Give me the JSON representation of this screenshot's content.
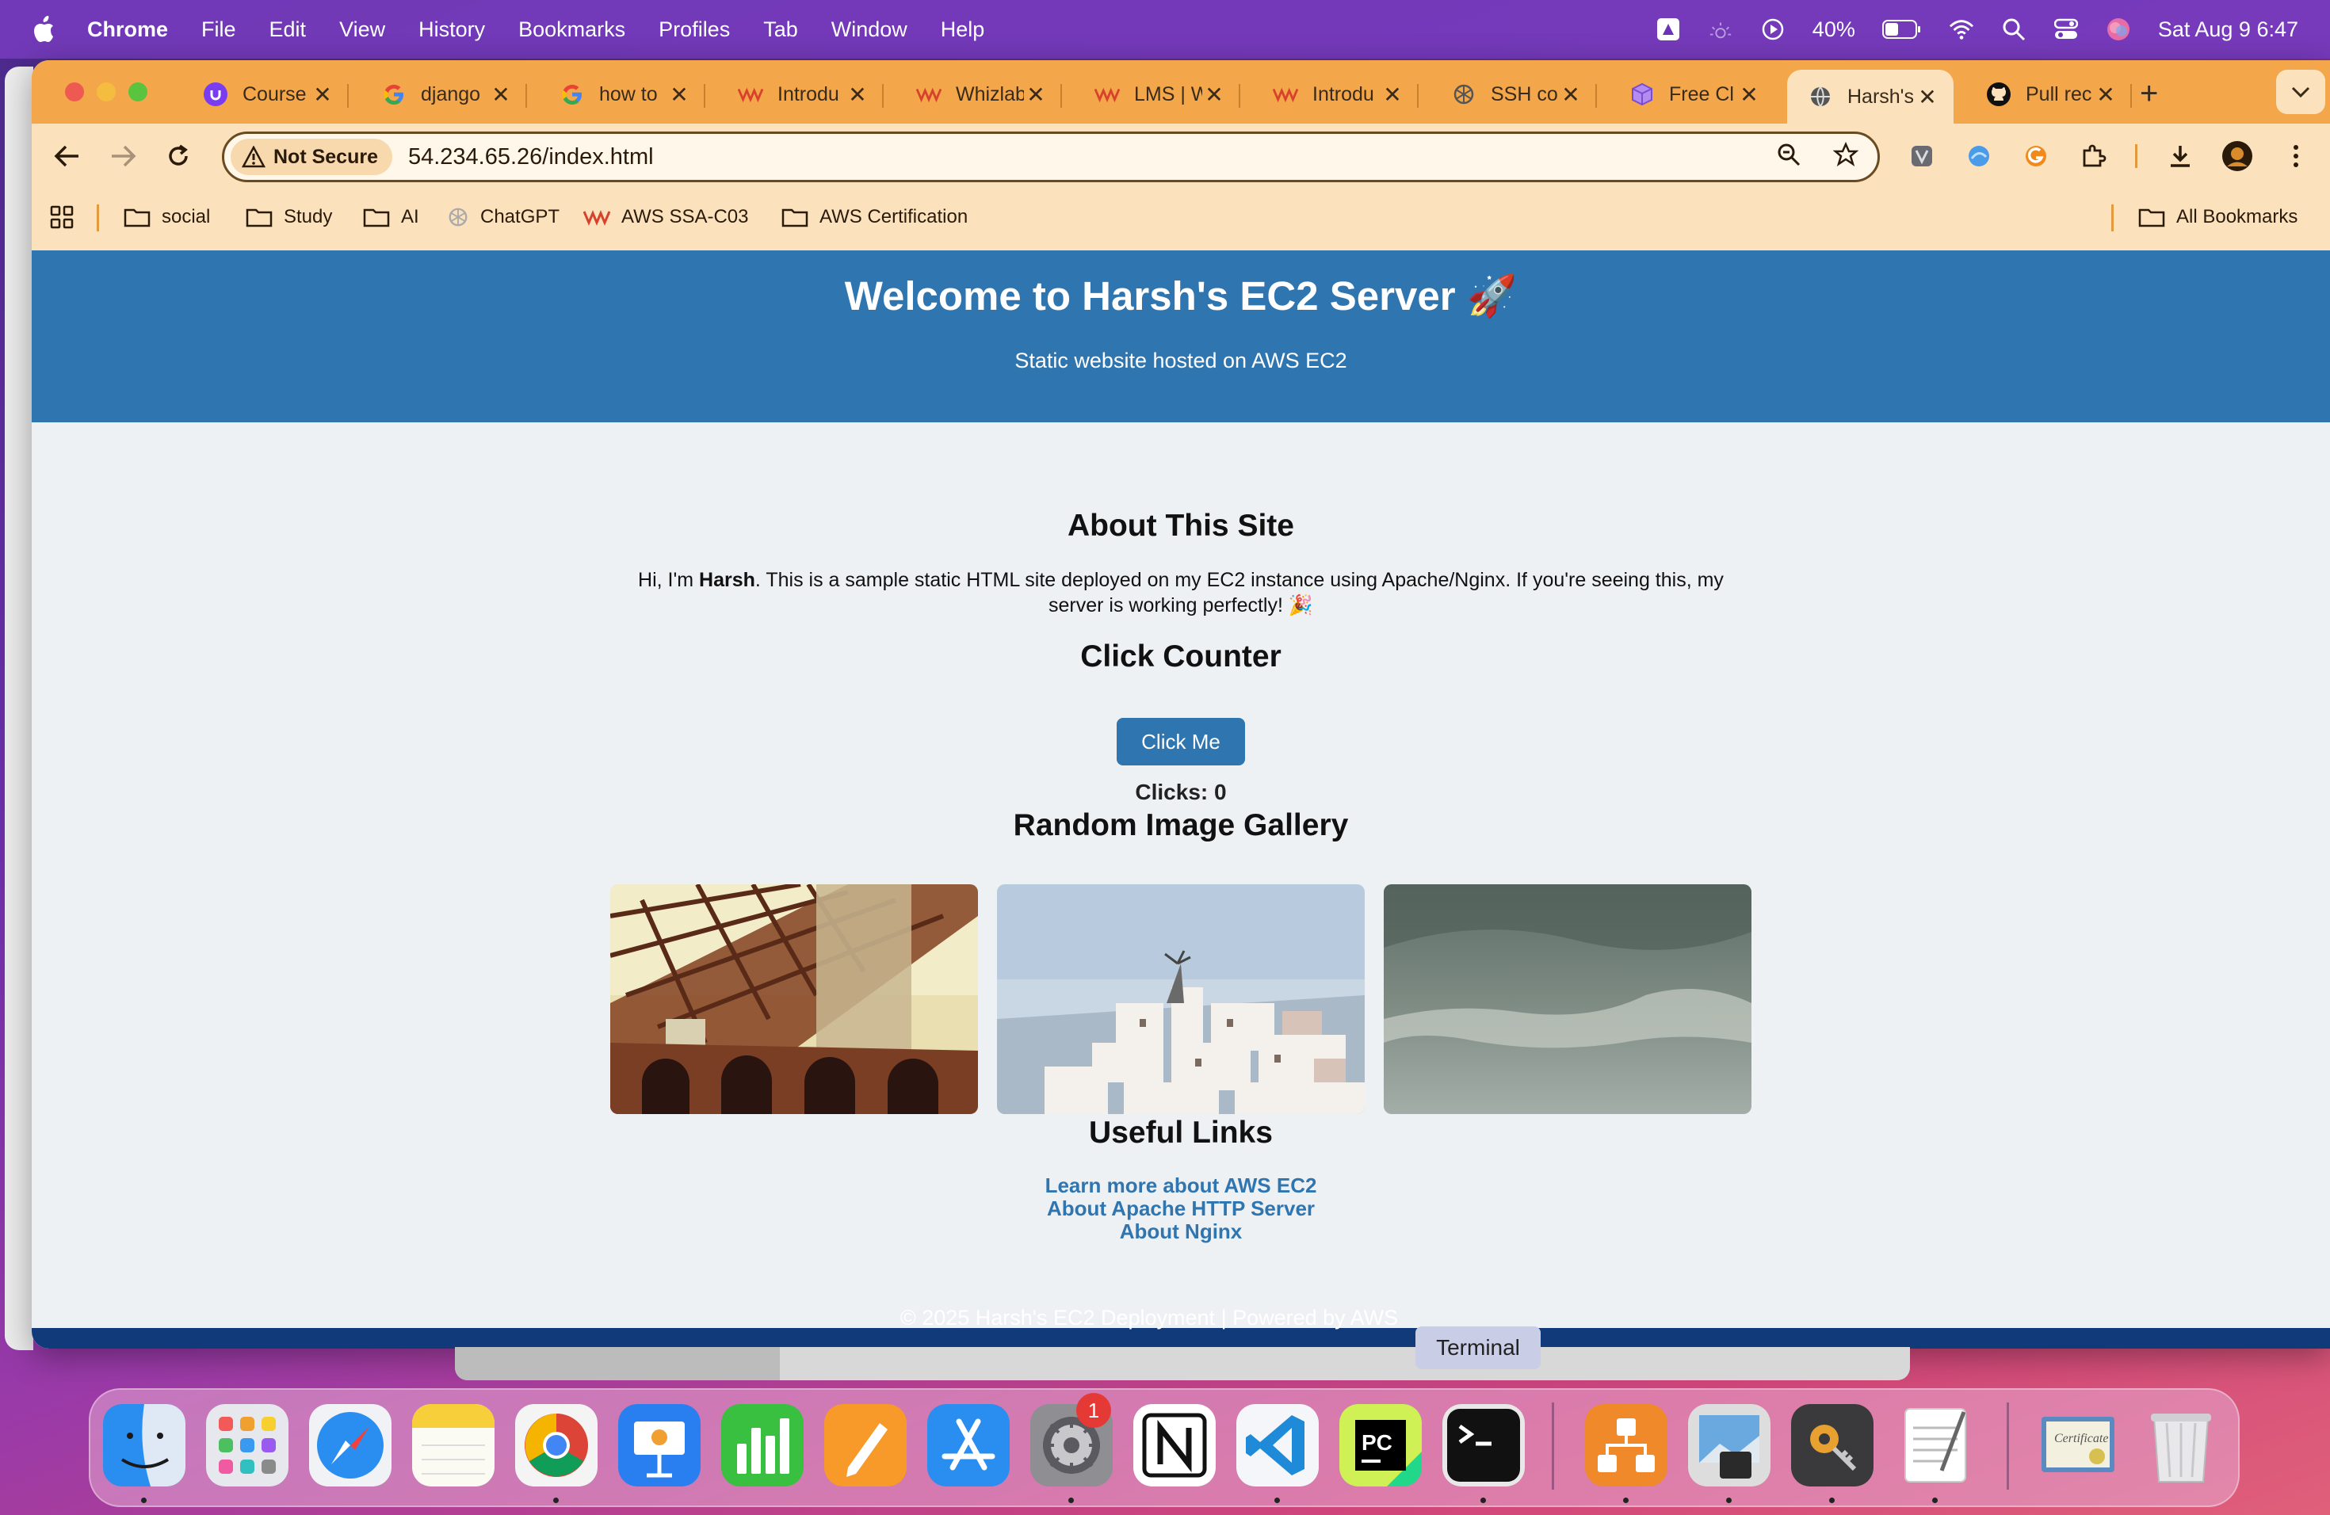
{
  "menubar": {
    "app_name": "Chrome",
    "menus": [
      "File",
      "Edit",
      "View",
      "History",
      "Bookmarks",
      "Profiles",
      "Tab",
      "Window",
      "Help"
    ],
    "battery": "40%",
    "clock": "Sat Aug 9  6:47"
  },
  "tabs": [
    {
      "title": "Course",
      "icon": "udemy-icon",
      "color": "#7a3cf0"
    },
    {
      "title": "django",
      "icon": "google-icon",
      "color": "#4285f4"
    },
    {
      "title": "how to",
      "icon": "google-icon",
      "color": "#4285f4"
    },
    {
      "title": "Introdu",
      "icon": "whizlabs-icon",
      "color": "#d8412c"
    },
    {
      "title": "Whizlab",
      "icon": "whizlabs-icon",
      "color": "#d8412c"
    },
    {
      "title": "LMS | W",
      "icon": "whizlabs-icon",
      "color": "#d8412c"
    },
    {
      "title": "Introdu",
      "icon": "whizlabs-icon",
      "color": "#d8412c"
    },
    {
      "title": "SSH co",
      "icon": "chatgpt-icon",
      "color": "#555555"
    },
    {
      "title": "Free Cl",
      "icon": "cube-icon",
      "color": "#8a5cd6"
    },
    {
      "title": "Harsh's",
      "icon": "globe-icon",
      "color": "#555555",
      "active": true
    },
    {
      "title": "Pull rec",
      "icon": "github-icon",
      "color": "#111111"
    }
  ],
  "toolbar": {
    "security_label": "Not Secure",
    "url": "54.234.65.26/index.html"
  },
  "bookmarks": {
    "items": [
      {
        "label": "social",
        "icon": "folder-icon"
      },
      {
        "label": "Study",
        "icon": "folder-icon"
      },
      {
        "label": "AI",
        "icon": "folder-icon"
      },
      {
        "label": "ChatGPT",
        "icon": "chatgpt-icon"
      },
      {
        "label": "AWS SSA-C03",
        "icon": "whizlabs-icon"
      },
      {
        "label": "AWS Certification",
        "icon": "folder-icon"
      }
    ],
    "all_label": "All Bookmarks"
  },
  "site": {
    "hero_title": "Welcome to Harsh's EC2 Server 🚀",
    "hero_subtitle": "Static website hosted on AWS EC2",
    "about_heading": "About This Site",
    "about_before": "Hi, I'm ",
    "about_name": "Harsh",
    "about_after": ". This is a sample static HTML site deployed on my EC2 instance using Apache/Nginx. If you're seeing this, my server is working perfectly! 🎉",
    "counter_heading": "Click Counter",
    "button_label": "Click Me",
    "clicks_text": "Clicks: 0",
    "gallery_heading": "Random Image Gallery",
    "links_heading": "Useful Links",
    "links": [
      "Learn more about AWS EC2",
      "About Apache HTTP Server",
      "About Nginx"
    ],
    "footer": "© 2025 Harsh's EC2 Deployment | Powered by AWS"
  },
  "tooltip": "Terminal",
  "dock": {
    "apps": [
      "finder-icon",
      "launchpad-icon",
      "safari-icon",
      "notes-icon",
      "chrome-icon",
      "keynote-icon",
      "numbers-icon",
      "pages-icon",
      "app-store-icon",
      "system-settings-icon",
      "notion-icon",
      "vscode-icon",
      "pycharm-icon",
      "terminal-icon",
      "cluster-app-icon",
      "preview-icon",
      "keychain-icon",
      "textedit-icon",
      "certificate-icon",
      "trash-icon"
    ],
    "settings_badge": "1"
  }
}
